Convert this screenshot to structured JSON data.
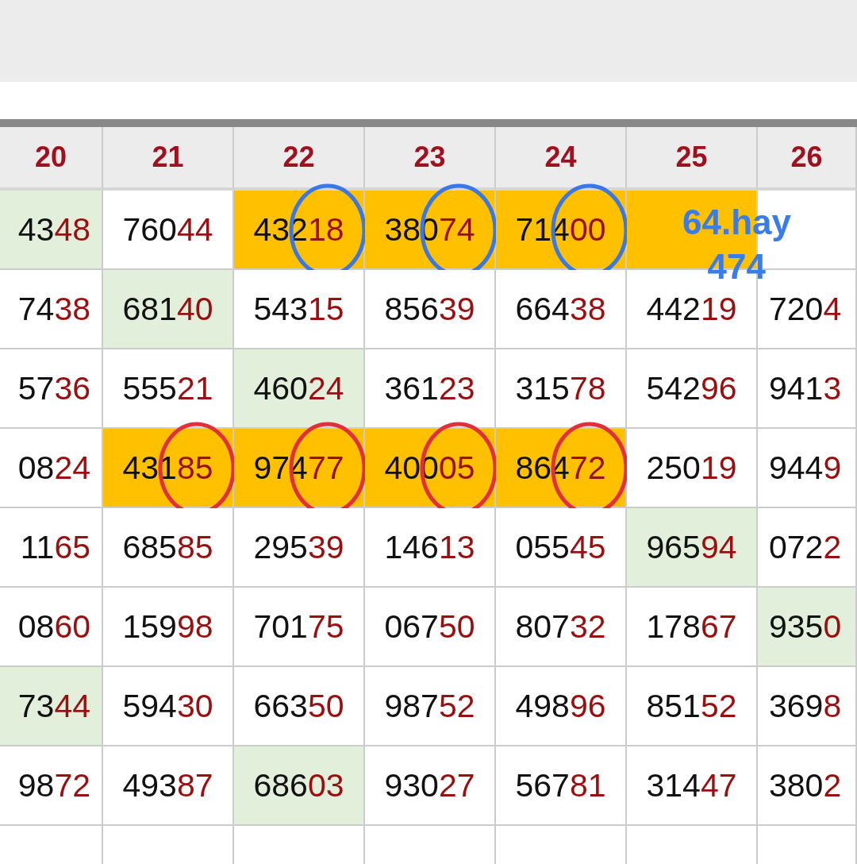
{
  "table": {
    "columns": [
      "20",
      "21",
      "22",
      "23",
      "24",
      "25",
      "26"
    ],
    "rows": [
      {
        "cells": [
          {
            "value": "4348",
            "color": "#e2efda"
          },
          {
            "value": "76044"
          },
          {
            "value": "43218",
            "color": "#ffc000",
            "circle": {
              "color": "#3a78e6"
            }
          },
          {
            "value": "38074",
            "color": "#ffc000",
            "circle": {
              "color": "#3a78e6"
            }
          },
          {
            "value": "71400",
            "color": "#ffc000",
            "circle": {
              "color": "#3a78e6"
            }
          },
          {
            "color": "#ffc000"
          },
          {}
        ]
      },
      {
        "cells": [
          {
            "value": "7438"
          },
          {
            "value": "68140",
            "color": "#e2efda"
          },
          {
            "value": "54315"
          },
          {
            "value": "85639"
          },
          {
            "value": "66438"
          },
          {
            "value": "44219"
          },
          {
            "value": "7204"
          }
        ]
      },
      {
        "cells": [
          {
            "value": "5736"
          },
          {
            "value": "55521"
          },
          {
            "value": "46024",
            "color": "#e2efda"
          },
          {
            "value": "36123"
          },
          {
            "value": "31578"
          },
          {
            "value": "54296"
          },
          {
            "value": "9413"
          }
        ]
      },
      {
        "cells": [
          {
            "value": "0824"
          },
          {
            "value": "43185",
            "color": "#ffc000",
            "circle": {
              "color": "#e0303c"
            }
          },
          {
            "value": "97477",
            "color": "#ffc000",
            "circle": {
              "color": "#e0303c"
            }
          },
          {
            "value": "40005",
            "color": "#ffc000",
            "circle": {
              "color": "#e0303c"
            }
          },
          {
            "value": "86472",
            "color": "#ffc000",
            "circle": {
              "color": "#e0303c"
            }
          },
          {
            "value": "25019"
          },
          {
            "value": "9449"
          }
        ]
      },
      {
        "cells": [
          {
            "value": "1165"
          },
          {
            "value": "68585"
          },
          {
            "value": "29539"
          },
          {
            "value": "14613"
          },
          {
            "value": "05545"
          },
          {
            "value": "96594",
            "color": "#e2efda"
          },
          {
            "value": "0722"
          }
        ]
      },
      {
        "cells": [
          {
            "value": "0860"
          },
          {
            "value": "15998"
          },
          {
            "value": "70175"
          },
          {
            "value": "06750"
          },
          {
            "value": "80732"
          },
          {
            "value": "17867"
          },
          {
            "value": "9350",
            "color": "#e2efda"
          }
        ]
      },
      {
        "cells": [
          {
            "value": "7344",
            "color": "#e2efda"
          },
          {
            "value": "59430"
          },
          {
            "value": "66350"
          },
          {
            "value": "98752"
          },
          {
            "value": "49896"
          },
          {
            "value": "85152"
          },
          {
            "value": "3698"
          }
        ]
      },
      {
        "cells": [
          {
            "value": "9872"
          },
          {
            "value": "49387"
          },
          {
            "value": "68603",
            "color": "#e2efda"
          },
          {
            "value": "93027"
          },
          {
            "value": "56781"
          },
          {
            "value": "31447"
          },
          {
            "value": "3802"
          }
        ]
      }
    ]
  },
  "note": {
    "lines": [
      "64.hay",
      "474"
    ]
  }
}
